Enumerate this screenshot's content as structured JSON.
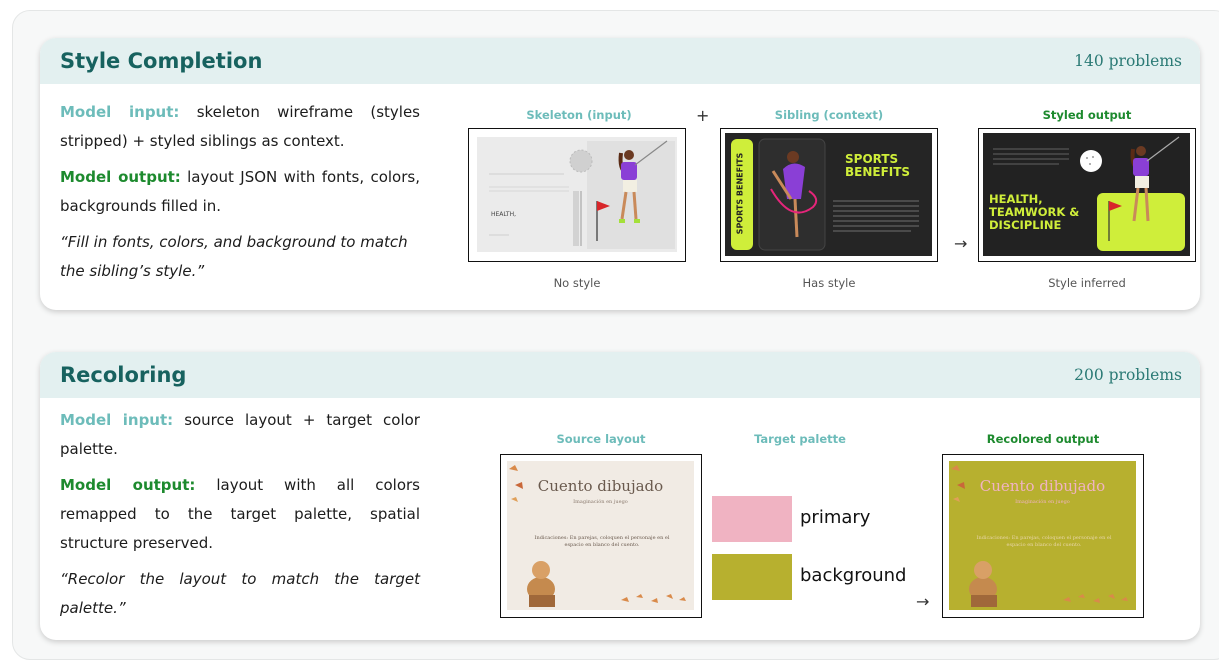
{
  "style_completion": {
    "title": "Style Completion",
    "count": "140 problems",
    "input_label": "Model input:",
    "input_text": "skeleton wireframe (styles stripped) + styled siblings as context.",
    "output_label": "Model output:",
    "output_text": "layout JSON with fonts, colors, backgrounds filled in.",
    "quote": "“Fill in fonts, colors, and background to match the sibling’s style.”",
    "panel1_caption": "Skeleton (input)",
    "plus": "+",
    "panel2_caption": "Sibling (context)",
    "panel3_caption": "Styled output",
    "arrow": "→",
    "panel1_sub": "No style",
    "panel2_sub": "Has style",
    "panel3_sub": "Style inferred",
    "skeleton_health": "HEALTH,",
    "sibling_title": "SPORTS BENEFITS",
    "sibling_side": "SPORTS BENEFITS",
    "output_headline": "HEALTH, TEAMWORK & DISCIPLINE"
  },
  "recoloring": {
    "title": "Recoloring",
    "count": "200 problems",
    "input_label": "Model input:",
    "input_text": "source layout + target color palette.",
    "output_label": "Model output:",
    "output_text": "layout with all colors remapped to the target palette, spatial structure preserved.",
    "quote": "“Recolor the layout to match the target palette.”",
    "panel1_caption": "Source layout",
    "panel2_caption": "Target palette",
    "panel3_caption": "Recolored output",
    "arrow": "→",
    "palette": [
      {
        "label": "primary",
        "color": "#f0b3c2"
      },
      {
        "label": "background",
        "color": "#b7b02f"
      }
    ],
    "slide_title": "Cuento dibujado",
    "slide_subtitle": "Imaginación en juego",
    "slide_body": "Indicaciones: En parejas, coloquen el personaje en el espacio en blanco del cuento."
  },
  "colors": {
    "accent_teal": "#17625f",
    "input_label": "#6dbcba",
    "output_label": "#1d8a2e",
    "lime": "#cfee3a",
    "dark_slide": "#2a2a2a"
  }
}
